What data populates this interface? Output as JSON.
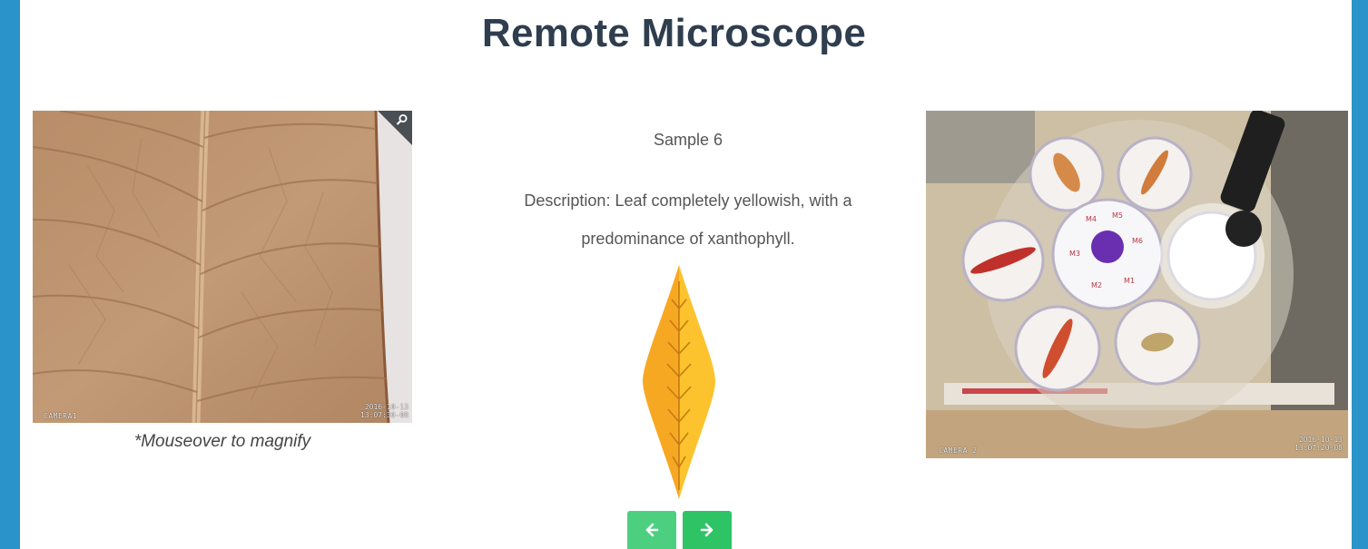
{
  "page": {
    "title": "Remote Microscope"
  },
  "microscope": {
    "camera_label": "CAMERA1",
    "timestamp_line1": "2016-10-13",
    "timestamp_line2": "13:07:30-08",
    "zoom_icon": "magnifier-icon",
    "hint": "*Mouseover to magnify"
  },
  "sample": {
    "name": "Sample 6",
    "description": "Description: Leaf completely yellowish, with a predominance of xanthophyll.",
    "leaf_colors": {
      "left": "#f7a823",
      "right": "#fcc32e",
      "vein": "#c77a14"
    }
  },
  "navigation": {
    "prev_icon": "arrow-left-icon",
    "next_icon": "arrow-right-icon"
  },
  "camera": {
    "camera_label": "CAMERA 2",
    "timestamp_line1": "2016-10-13",
    "timestamp_line2": "13:07:20-08",
    "disc_labels": [
      "M4",
      "M5",
      "M6",
      "M1",
      "M2",
      "M3"
    ]
  },
  "colors": {
    "frame": "#2a93c9",
    "title": "#2f3e4e",
    "button_prev": "#4cd07f",
    "button_next": "#2ec466"
  }
}
